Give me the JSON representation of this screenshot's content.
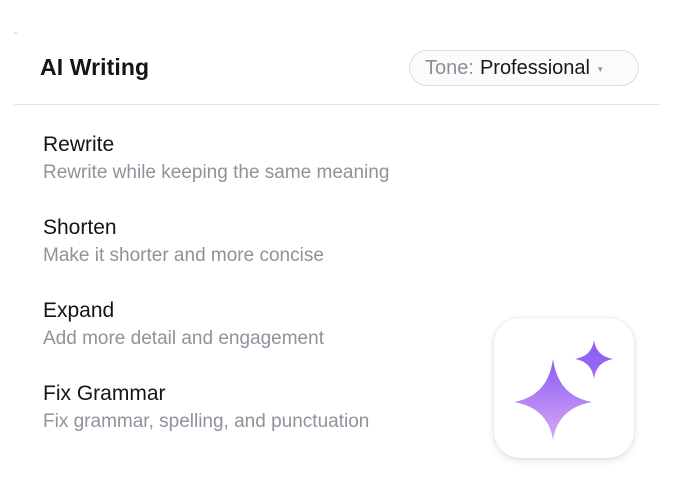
{
  "header": {
    "title": "AI Writing",
    "tone_label": "Tone:",
    "tone_value": "Professional",
    "tone_caret": "▾"
  },
  "actions": [
    {
      "title": "Rewrite",
      "description": "Rewrite while keeping the same meaning"
    },
    {
      "title": "Shorten",
      "description": "Make it shorter and more concise"
    },
    {
      "title": "Expand",
      "description": "Add more detail and engagement"
    },
    {
      "title": "Fix Grammar",
      "description": "Fix grammar, spelling, and punctuation"
    }
  ],
  "app_icon": {
    "icon": "sparkles-icon",
    "colors": {
      "gradient_top": "#8b5cf6",
      "gradient_bottom": "#d6a4f5",
      "small_star": "#8b5cf6"
    }
  }
}
